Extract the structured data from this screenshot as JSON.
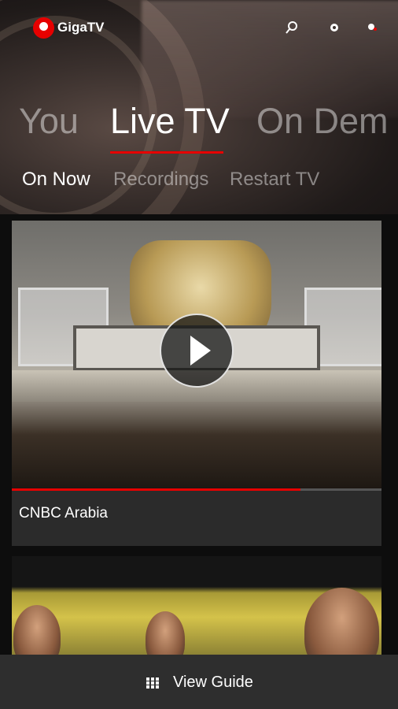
{
  "header": {
    "brand": "GigaTV",
    "icons": [
      "search-icon",
      "settings-icon",
      "profile-icon"
    ]
  },
  "main_tabs": [
    {
      "label": "You",
      "active": false
    },
    {
      "label": "Live TV",
      "active": true
    },
    {
      "label": "On Dem",
      "active": false
    }
  ],
  "sub_tabs": [
    {
      "label": "On Now",
      "active": true
    },
    {
      "label": "Recordings",
      "active": false
    },
    {
      "label": "Restart TV",
      "active": false
    }
  ],
  "cards": [
    {
      "channel": "CNBC Arabia",
      "progress": 0.78
    },
    {
      "channel": ""
    }
  ],
  "bottom_bar": {
    "label": "View Guide"
  },
  "colors": {
    "accent": "#e60000",
    "card_info_bg": "#2b2b2b",
    "bottom_bar_bg": "#2e2e2e"
  }
}
